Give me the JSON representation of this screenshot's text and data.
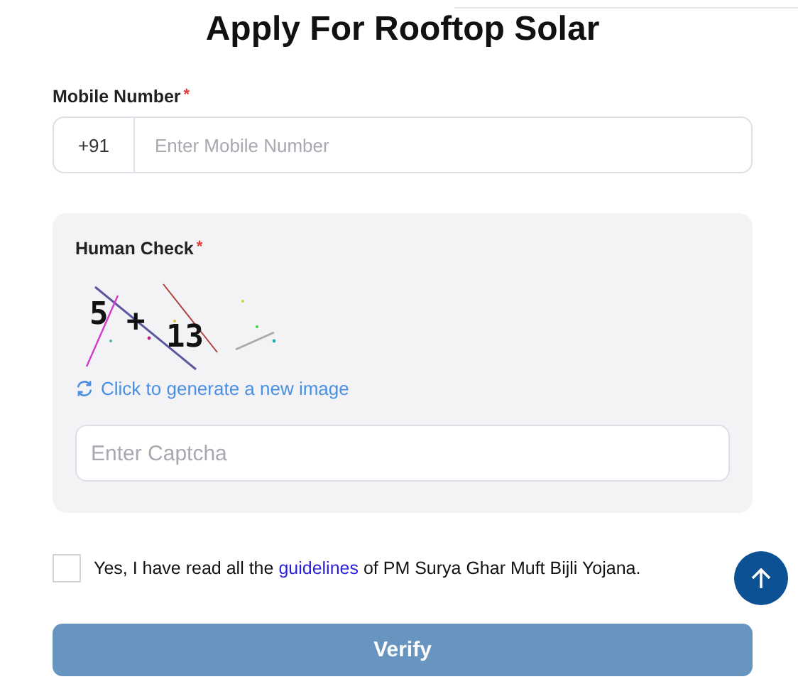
{
  "title": "Apply For Rooftop Solar",
  "mobile": {
    "label": "Mobile Number",
    "required_mark": "*",
    "prefix": "+91",
    "placeholder": "Enter Mobile Number"
  },
  "human_check": {
    "label": "Human Check",
    "required_mark": "*",
    "captcha_text": "5 + 13",
    "refresh_link": "Click to generate a new image",
    "placeholder": "Enter Captcha"
  },
  "agreement": {
    "checked": false,
    "text_before": "Yes, I have read all the",
    "link": "guidelines",
    "text_after": "of PM Surya Ghar Muft Bijli Yojana."
  },
  "verify_button": {
    "label": "Verify",
    "disabled": true
  }
}
